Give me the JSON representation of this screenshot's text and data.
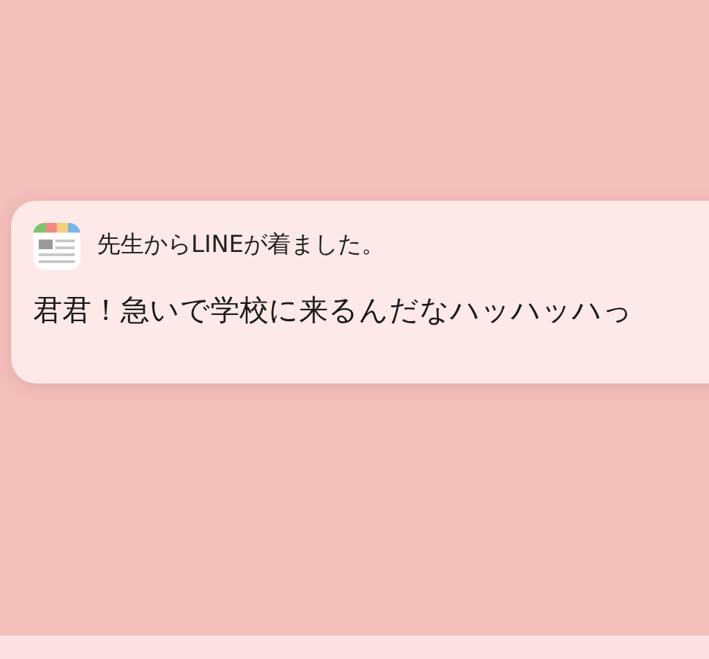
{
  "notification": {
    "title": "先生からLINEが着ました。",
    "message": "君君！急いで学校に来るんだなハッハッハっ"
  }
}
